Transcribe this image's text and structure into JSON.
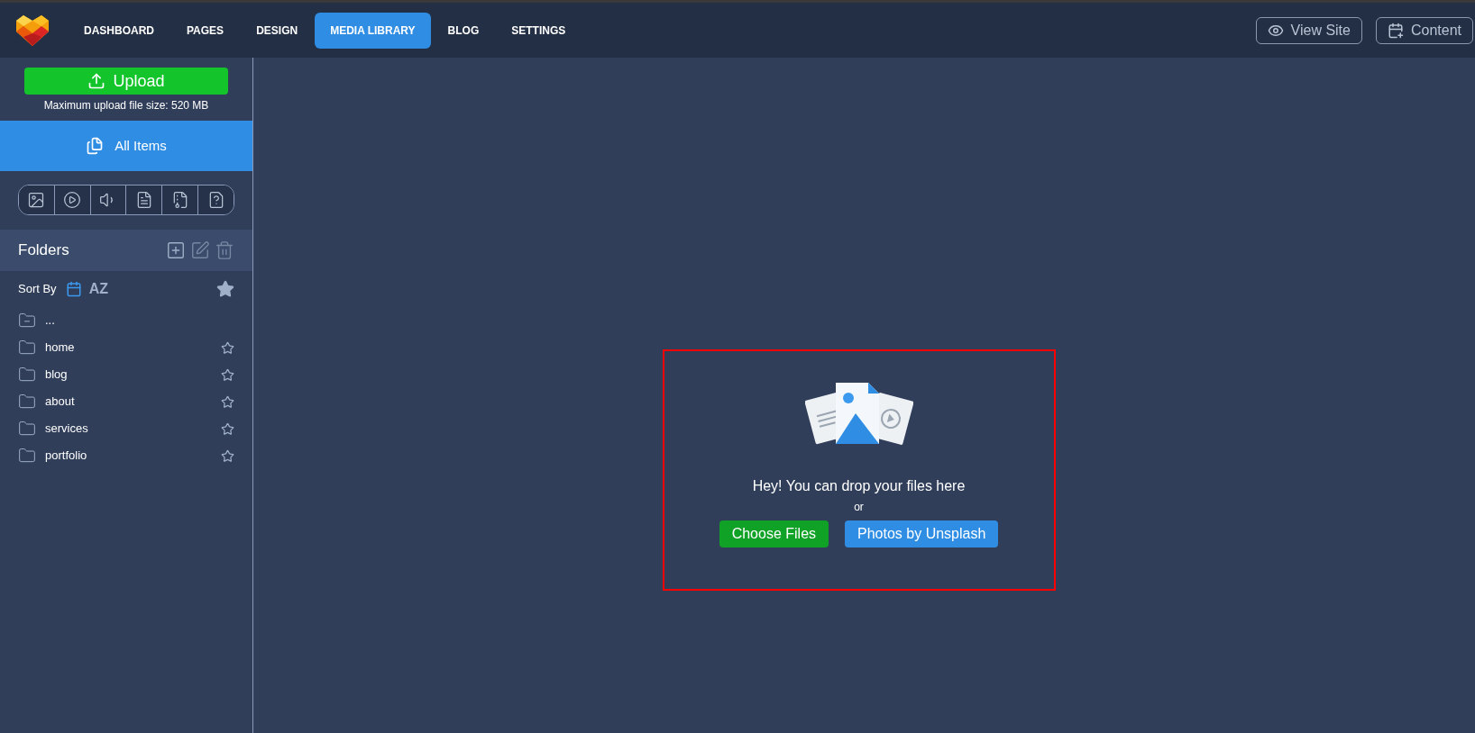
{
  "nav": {
    "tabs": [
      {
        "label": "DASHBOARD",
        "selected": false
      },
      {
        "label": "PAGES",
        "selected": false
      },
      {
        "label": "DESIGN",
        "selected": false
      },
      {
        "label": "MEDIA LIBRARY",
        "selected": true
      },
      {
        "label": "BLOG",
        "selected": false
      },
      {
        "label": "SETTINGS",
        "selected": false
      }
    ],
    "actions": [
      {
        "kind": "view",
        "label": "View Site"
      },
      {
        "kind": "content",
        "label": "Content"
      }
    ]
  },
  "sidebar": {
    "upload": {
      "label": "Upload",
      "note": "Maximum upload file size: 520 MB"
    },
    "all_items": {
      "label": "All Items",
      "selected": true
    },
    "filters": [
      {
        "kind": "image",
        "selected": false
      },
      {
        "kind": "video",
        "selected": false
      },
      {
        "kind": "audio",
        "selected": false
      },
      {
        "kind": "document",
        "selected": false
      },
      {
        "kind": "archive",
        "selected": false
      },
      {
        "kind": "other",
        "selected": false
      }
    ],
    "folders_title": "Folders",
    "sort": {
      "label": "Sort By",
      "options": [
        {
          "kind": "date",
          "selected": true
        },
        {
          "kind": "alpha",
          "label": "AZ",
          "selected": false
        }
      ],
      "favorites_only": true
    },
    "folders": [
      {
        "kind": "parent",
        "name": "..."
      },
      {
        "kind": "folder",
        "name": "home",
        "starred": false
      },
      {
        "kind": "folder",
        "name": "blog",
        "starred": false
      },
      {
        "kind": "folder",
        "name": "about",
        "starred": false
      },
      {
        "kind": "folder",
        "name": "services",
        "starred": false
      },
      {
        "kind": "folder",
        "name": "portfolio",
        "starred": false
      }
    ]
  },
  "dropzone": {
    "message": "Hey! You can drop your files here",
    "or": "or",
    "buttons": [
      {
        "kind": "choose",
        "label": "Choose Files"
      },
      {
        "kind": "unsplash",
        "label": "Photos by Unsplash"
      }
    ]
  }
}
